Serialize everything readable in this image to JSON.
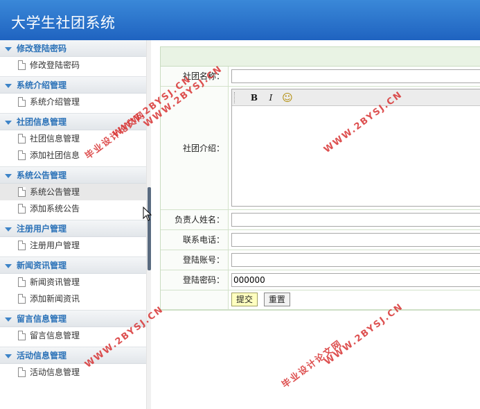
{
  "header": {
    "title": "大学生社团系统"
  },
  "sidebar": {
    "groups": [
      {
        "title": "修改登陆密码",
        "items": [
          "修改登陆密码"
        ]
      },
      {
        "title": "系统介绍管理",
        "items": [
          "系统介绍管理"
        ]
      },
      {
        "title": "社团信息管理",
        "items": [
          "社团信息管理",
          "添加社团信息"
        ]
      },
      {
        "title": "系统公告管理",
        "items": [
          "系统公告管理",
          "添加系统公告"
        ]
      },
      {
        "title": "注册用户管理",
        "items": [
          "注册用户管理"
        ]
      },
      {
        "title": "新闻资讯管理",
        "items": [
          "新闻资讯管理",
          "添加新闻资讯"
        ]
      },
      {
        "title": "留言信息管理",
        "items": [
          "留言信息管理"
        ]
      },
      {
        "title": "活动信息管理",
        "items": [
          "活动信息管理"
        ]
      }
    ],
    "active_item": "系统公告管理"
  },
  "form": {
    "club_name_label": "社团名称：",
    "club_name_value": "",
    "intro_label": "社团介绍：",
    "editor_buttons": {
      "bold": "B",
      "italic": "I",
      "emoji": "☺"
    },
    "leader_label": "负责人姓名：",
    "leader_value": "",
    "phone_label": "联系电话：",
    "phone_value": "",
    "account_label": "登陆账号：",
    "account_value": "",
    "password_label": "登陆密码：",
    "password_value": "000000",
    "submit_label": "提交",
    "reset_label": "重置"
  },
  "watermarks": {
    "url": "WWW.2BYSJ.CN",
    "site": "毕业设计论文网"
  },
  "colors": {
    "header_bg": "#2a75cc",
    "group_text": "#2b72b8",
    "form_border": "#c9dcc0",
    "watermark": "#d83232"
  }
}
